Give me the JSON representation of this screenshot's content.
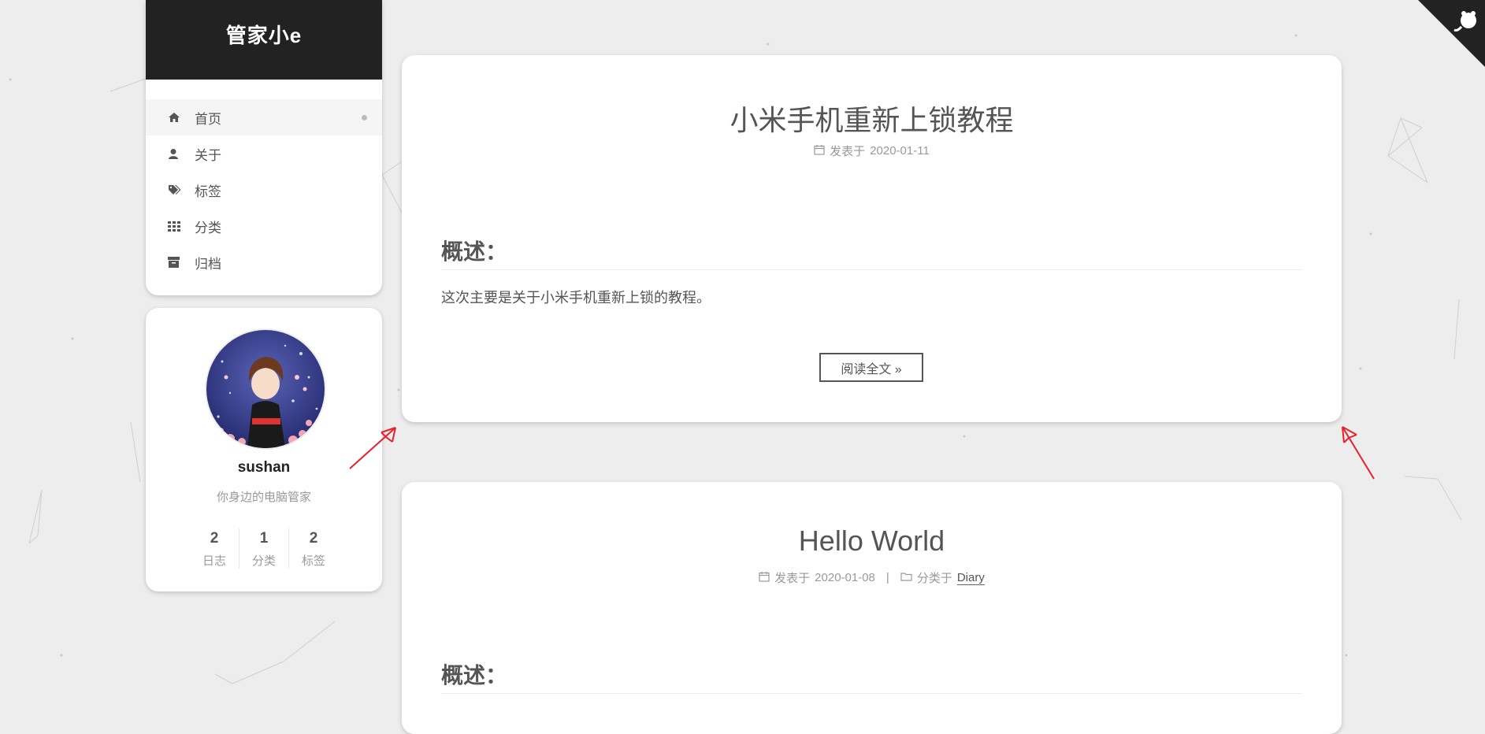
{
  "site": {
    "brand_title": "管家小e"
  },
  "menu": [
    {
      "label": "首页",
      "icon": "home-icon",
      "active": true
    },
    {
      "label": "关于",
      "icon": "user-icon"
    },
    {
      "label": "标签",
      "icon": "tags-icon"
    },
    {
      "label": "分类",
      "icon": "th-icon"
    },
    {
      "label": "归档",
      "icon": "archive-icon"
    }
  ],
  "profile": {
    "author": "sushan",
    "description": "你身边的电脑管家",
    "stats": [
      {
        "count": "2",
        "label": "日志"
      },
      {
        "count": "1",
        "label": "分类"
      },
      {
        "count": "2",
        "label": "标签"
      }
    ]
  },
  "posts": [
    {
      "title": "小米手机重新上锁教程",
      "meta_prefix": "发表于",
      "date": "2020-01-11",
      "section_heading": "概述：",
      "excerpt": "这次主要是关于小米手机重新上锁的教程。",
      "read_more": "阅读全文 »"
    },
    {
      "title": "Hello World",
      "meta_prefix": "发表于",
      "date": "2020-01-08",
      "meta_separator": "|",
      "category_prefix": "分类于",
      "category": "Diary",
      "section_heading": "概述："
    }
  ],
  "colors": {
    "header_bg": "#222222",
    "page_bg": "#ededed",
    "annotation_arrow": "#e8202a"
  }
}
